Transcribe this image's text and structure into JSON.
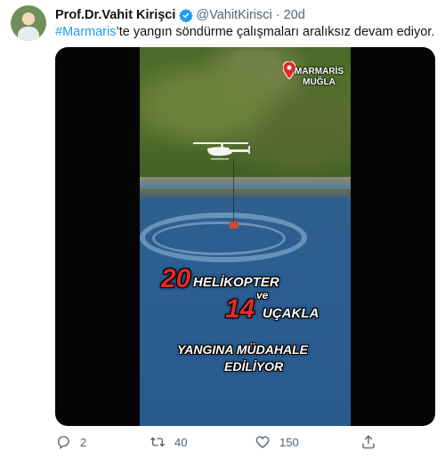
{
  "tweet": {
    "author_name": "Prof.Dr.Vahit Kirişci",
    "handle": "@VahitKirisci",
    "separator": "·",
    "time": "20d",
    "hashtag": "#Marmaris",
    "text_rest": "’te yangın söndürme çalışmaları aralıksız devam ediyor."
  },
  "video_overlay": {
    "location_line1": "MARMARİS",
    "location_line2": "MUĞLA",
    "num1": "20",
    "word1": "HELİKOPTER",
    "word_ve": "ve",
    "num2": "14",
    "word2": "UÇAKLA",
    "line3": "YANGINA MÜDAHALE",
    "line4": "EDİLİYOR"
  },
  "actions": {
    "reply_count": "2",
    "retweet_count": "40",
    "like_count": "150"
  },
  "icons": {
    "verified": "verified-badge-icon",
    "reply": "reply-icon",
    "retweet": "retweet-icon",
    "like": "heart-icon",
    "share": "share-icon",
    "location": "map-pin-icon"
  },
  "colors": {
    "link": "#1d9bf0",
    "muted": "#536471",
    "overlay_number": "#e02a28"
  }
}
